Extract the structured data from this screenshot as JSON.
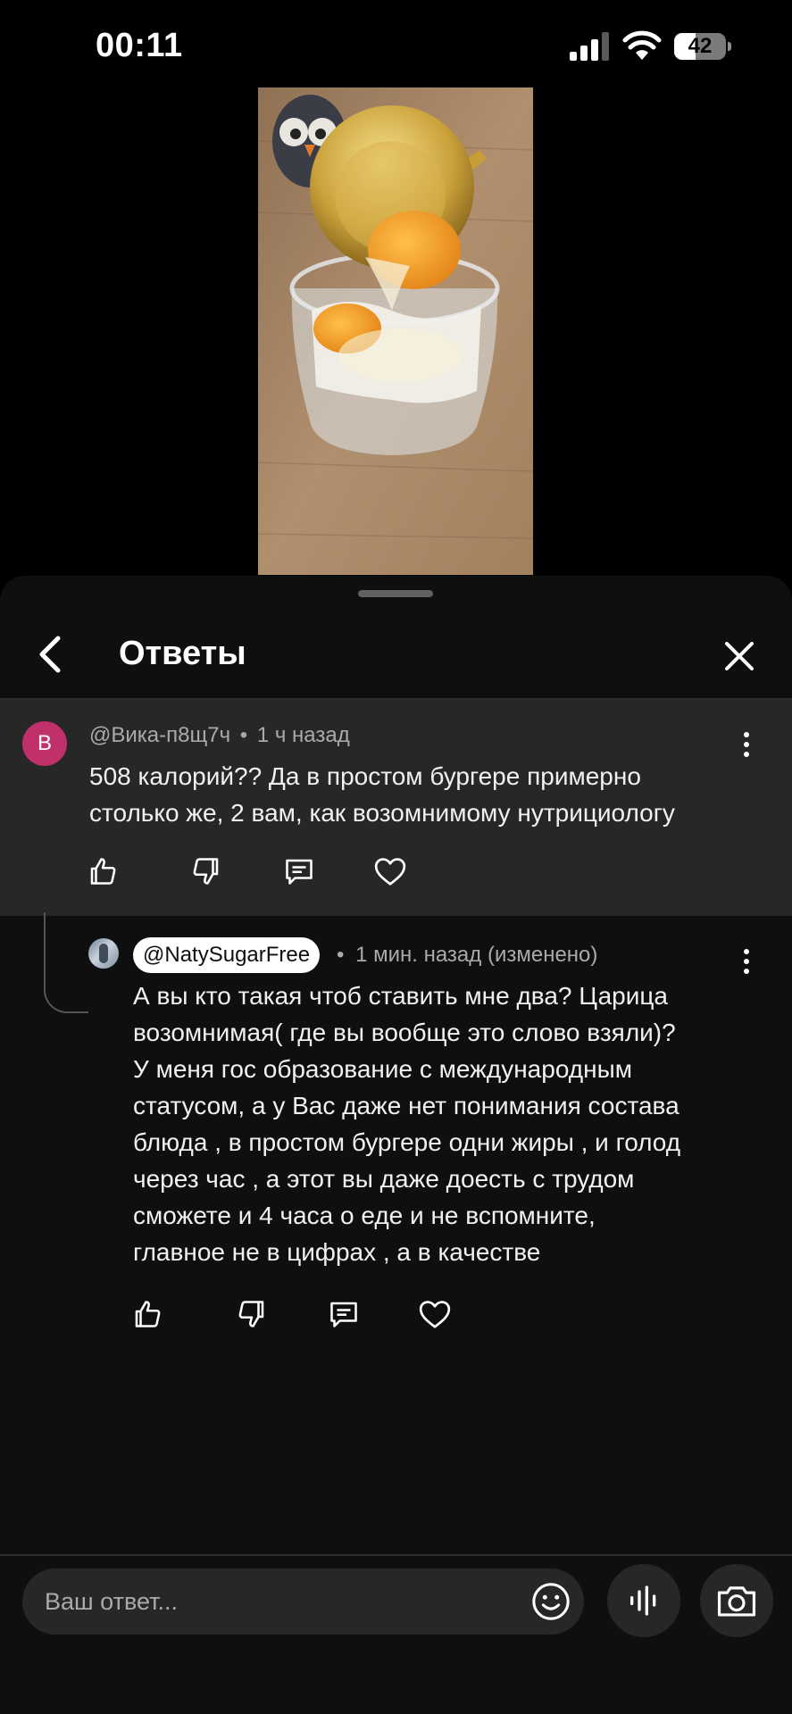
{
  "status_bar": {
    "time": "00:11",
    "battery": "42",
    "battery_fraction": 0.42
  },
  "sheet": {
    "title": "Ответы"
  },
  "parent_comment": {
    "avatar_letter": "В",
    "author": "@Вика-п8щ7ч",
    "separator": "•",
    "time": "1 ч назад",
    "lines": [
      "508 калорий?? Да в простом бургере примерно",
      "столько же, 2 вам, как возомнимому нутрициологу"
    ]
  },
  "reply": {
    "author": "@NatySugarFree",
    "separator": "•",
    "time": "1 мин. назад (изменено)",
    "lines": [
      "А вы кто такая чтоб ставить мне два? Царица",
      "возомнимая( где вы вообще это слово взяли)?",
      "У меня гос образование с международным",
      "статусом, а у Вас даже нет понимания состава",
      "блюда , в простом бургере одни жиры , и голод",
      "через час , а этот вы даже доесть с трудом",
      "сможете и 4 часа о еде и не вспомните,",
      "главное не в цифрах , а в качестве"
    ]
  },
  "input": {
    "placeholder": "Ваш ответ..."
  },
  "colors": {
    "background": "#0f0f0f",
    "highlight_row": "#272727",
    "avatar_accent": "#c0306a",
    "secondary_text": "#aaaaaa"
  },
  "icons": {
    "back": "chevron-left-icon",
    "close": "close-icon",
    "more": "more-vertical-icon",
    "like": "thumbs-up-icon",
    "dislike": "thumbs-down-icon",
    "reply": "comment-icon",
    "heart": "heart-icon",
    "emoji": "smiley-icon",
    "voice": "voice-icon",
    "camera": "camera-icon"
  }
}
